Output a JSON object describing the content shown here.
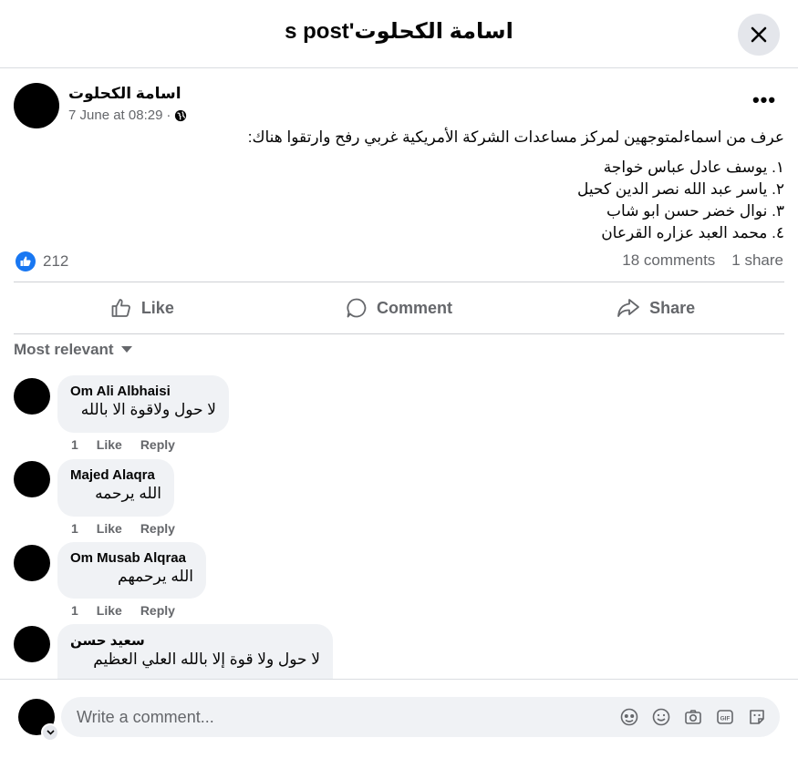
{
  "header": {
    "title": "اسامة الكحلوت's post"
  },
  "post": {
    "author": "اسامة الكحلوت",
    "date": "7 June at 08:29",
    "separator": "·",
    "intro": "عرف من اسماءلمتوجهين لمركز مساعدات الشركة الأمريكية غربي رفح وارتقوا هناك:",
    "list": [
      "١. يوسف عادل عباس خواجة",
      "٢. ياسر عبد الله نصر الدين كحيل",
      "٣. نوال خضر حسن ابو شاب",
      "٤. محمد العبد عزاره القرعان"
    ],
    "like_count": "212",
    "comments_count": "18 comments",
    "shares_count": "1 share"
  },
  "actions": {
    "like": "Like",
    "comment": "Comment",
    "share": "Share"
  },
  "sort": {
    "label": "Most relevant"
  },
  "comments": [
    {
      "author": "Om Ali Albhaisi",
      "text": "لا حول ولاقوة الا بالله",
      "likes": "1",
      "like": "Like",
      "reply": "Reply"
    },
    {
      "author": "Majed Alaqra",
      "text": "الله يرحمه",
      "likes": "1",
      "like": "Like",
      "reply": "Reply"
    },
    {
      "author": "Om Musab Alqraa",
      "text": "الله يرحمهم",
      "likes": "1",
      "like": "Like",
      "reply": "Reply"
    },
    {
      "author": "سعيد حسن",
      "text": "لا حول ولا قوة إلا بالله العلي العظيم"
    }
  ],
  "composer": {
    "placeholder": "Write a comment..."
  },
  "colors": {
    "like_blue": "#1877f2",
    "secondary_text": "#65676b",
    "bubble_bg": "#f0f2f5"
  },
  "icons": [
    "close-icon",
    "globe-icon",
    "more-icon",
    "like-reaction-icon",
    "thumb-up-icon",
    "comment-icon",
    "share-icon",
    "caret-down-icon",
    "avatar-sticker-icon",
    "emoji-icon",
    "camera-icon",
    "gif-icon",
    "sticker-icon",
    "chevron-down-icon"
  ]
}
